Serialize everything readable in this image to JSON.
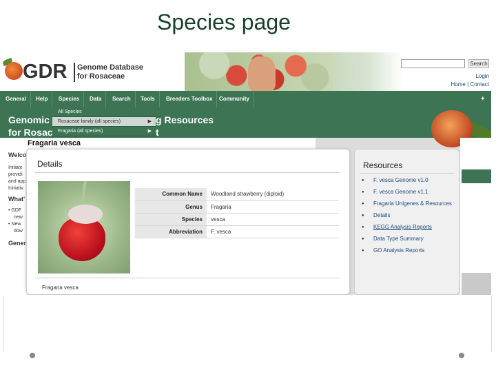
{
  "slide": {
    "title": "Species page"
  },
  "header": {
    "logo_text": "GDR",
    "logo_subtitle_1": "Genome Database",
    "logo_subtitle_2": "for Rosaceae",
    "search_button": "Search",
    "login": "Login",
    "home": "Home",
    "contact": "Contact",
    "separator": "|"
  },
  "nav": {
    "items": [
      "General",
      "Help",
      "Species",
      "Data",
      "Search",
      "Tools",
      "Breeders Toolbox",
      "Community"
    ]
  },
  "dropdown": {
    "items": [
      {
        "label": "All Species",
        "arrow": ""
      },
      {
        "label": "Rosaceae family (all species)",
        "arrow": "▶"
      },
      {
        "label": "Fragaria (all species)",
        "arrow": "▶"
      }
    ]
  },
  "banner": {
    "line1_left": "Genomic",
    "line1_right": "g Resources",
    "line2_left": "for Rosac",
    "line2_right": "t"
  },
  "background_text": {
    "welcome": "Welco",
    "whats": "What'",
    "general": "Genera",
    "lines": [
      "Initiate",
      "providi",
      "and app",
      "Initiativ"
    ],
    "bullets": [
      "GDF",
      "new",
      "New",
      "dow"
    ]
  },
  "species": {
    "title": "Fragaria vesca"
  },
  "details": {
    "heading": "Details",
    "rows": [
      {
        "key": "Common Name",
        "value": "Woodland strawberry (diploid)"
      },
      {
        "key": "Genus",
        "value": "Fragaria"
      },
      {
        "key": "Species",
        "value": "vesca"
      },
      {
        "key": "Abbreviation",
        "value": "F. vesca"
      }
    ],
    "caption": "Fragaria vesca"
  },
  "resources": {
    "heading": "Resources",
    "items": [
      "F. vesca Genome v1.0",
      "F. vesca Genome v1.1",
      "Fragaria Unigenes & Resources",
      "Details",
      "KEGG Analysis Reports",
      "Data Type Summary",
      "GO Analysis Reports"
    ]
  },
  "colors": {
    "nav_green": "#3c7454",
    "title_green": "#17412c",
    "link_blue": "#1c4a7a"
  }
}
